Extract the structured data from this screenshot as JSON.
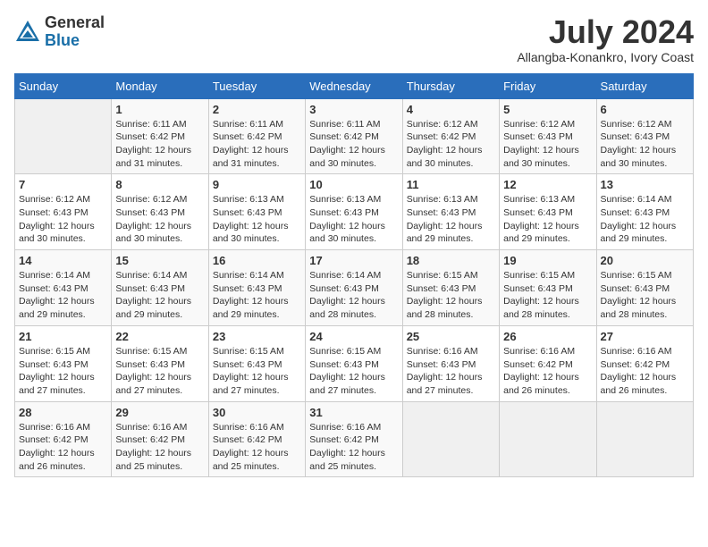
{
  "header": {
    "logo_general": "General",
    "logo_blue": "Blue",
    "month_title": "July 2024",
    "subtitle": "Allangba-Konankro, Ivory Coast"
  },
  "days_of_week": [
    "Sunday",
    "Monday",
    "Tuesday",
    "Wednesday",
    "Thursday",
    "Friday",
    "Saturday"
  ],
  "weeks": [
    [
      {
        "day": "",
        "info": ""
      },
      {
        "day": "1",
        "info": "Sunrise: 6:11 AM\nSunset: 6:42 PM\nDaylight: 12 hours\nand 31 minutes."
      },
      {
        "day": "2",
        "info": "Sunrise: 6:11 AM\nSunset: 6:42 PM\nDaylight: 12 hours\nand 31 minutes."
      },
      {
        "day": "3",
        "info": "Sunrise: 6:11 AM\nSunset: 6:42 PM\nDaylight: 12 hours\nand 30 minutes."
      },
      {
        "day": "4",
        "info": "Sunrise: 6:12 AM\nSunset: 6:42 PM\nDaylight: 12 hours\nand 30 minutes."
      },
      {
        "day": "5",
        "info": "Sunrise: 6:12 AM\nSunset: 6:43 PM\nDaylight: 12 hours\nand 30 minutes."
      },
      {
        "day": "6",
        "info": "Sunrise: 6:12 AM\nSunset: 6:43 PM\nDaylight: 12 hours\nand 30 minutes."
      }
    ],
    [
      {
        "day": "7",
        "info": "Sunrise: 6:12 AM\nSunset: 6:43 PM\nDaylight: 12 hours\nand 30 minutes."
      },
      {
        "day": "8",
        "info": "Sunrise: 6:12 AM\nSunset: 6:43 PM\nDaylight: 12 hours\nand 30 minutes."
      },
      {
        "day": "9",
        "info": "Sunrise: 6:13 AM\nSunset: 6:43 PM\nDaylight: 12 hours\nand 30 minutes."
      },
      {
        "day": "10",
        "info": "Sunrise: 6:13 AM\nSunset: 6:43 PM\nDaylight: 12 hours\nand 30 minutes."
      },
      {
        "day": "11",
        "info": "Sunrise: 6:13 AM\nSunset: 6:43 PM\nDaylight: 12 hours\nand 29 minutes."
      },
      {
        "day": "12",
        "info": "Sunrise: 6:13 AM\nSunset: 6:43 PM\nDaylight: 12 hours\nand 29 minutes."
      },
      {
        "day": "13",
        "info": "Sunrise: 6:14 AM\nSunset: 6:43 PM\nDaylight: 12 hours\nand 29 minutes."
      }
    ],
    [
      {
        "day": "14",
        "info": "Sunrise: 6:14 AM\nSunset: 6:43 PM\nDaylight: 12 hours\nand 29 minutes."
      },
      {
        "day": "15",
        "info": "Sunrise: 6:14 AM\nSunset: 6:43 PM\nDaylight: 12 hours\nand 29 minutes."
      },
      {
        "day": "16",
        "info": "Sunrise: 6:14 AM\nSunset: 6:43 PM\nDaylight: 12 hours\nand 29 minutes."
      },
      {
        "day": "17",
        "info": "Sunrise: 6:14 AM\nSunset: 6:43 PM\nDaylight: 12 hours\nand 28 minutes."
      },
      {
        "day": "18",
        "info": "Sunrise: 6:15 AM\nSunset: 6:43 PM\nDaylight: 12 hours\nand 28 minutes."
      },
      {
        "day": "19",
        "info": "Sunrise: 6:15 AM\nSunset: 6:43 PM\nDaylight: 12 hours\nand 28 minutes."
      },
      {
        "day": "20",
        "info": "Sunrise: 6:15 AM\nSunset: 6:43 PM\nDaylight: 12 hours\nand 28 minutes."
      }
    ],
    [
      {
        "day": "21",
        "info": "Sunrise: 6:15 AM\nSunset: 6:43 PM\nDaylight: 12 hours\nand 27 minutes."
      },
      {
        "day": "22",
        "info": "Sunrise: 6:15 AM\nSunset: 6:43 PM\nDaylight: 12 hours\nand 27 minutes."
      },
      {
        "day": "23",
        "info": "Sunrise: 6:15 AM\nSunset: 6:43 PM\nDaylight: 12 hours\nand 27 minutes."
      },
      {
        "day": "24",
        "info": "Sunrise: 6:15 AM\nSunset: 6:43 PM\nDaylight: 12 hours\nand 27 minutes."
      },
      {
        "day": "25",
        "info": "Sunrise: 6:16 AM\nSunset: 6:43 PM\nDaylight: 12 hours\nand 27 minutes."
      },
      {
        "day": "26",
        "info": "Sunrise: 6:16 AM\nSunset: 6:42 PM\nDaylight: 12 hours\nand 26 minutes."
      },
      {
        "day": "27",
        "info": "Sunrise: 6:16 AM\nSunset: 6:42 PM\nDaylight: 12 hours\nand 26 minutes."
      }
    ],
    [
      {
        "day": "28",
        "info": "Sunrise: 6:16 AM\nSunset: 6:42 PM\nDaylight: 12 hours\nand 26 minutes."
      },
      {
        "day": "29",
        "info": "Sunrise: 6:16 AM\nSunset: 6:42 PM\nDaylight: 12 hours\nand 25 minutes."
      },
      {
        "day": "30",
        "info": "Sunrise: 6:16 AM\nSunset: 6:42 PM\nDaylight: 12 hours\nand 25 minutes."
      },
      {
        "day": "31",
        "info": "Sunrise: 6:16 AM\nSunset: 6:42 PM\nDaylight: 12 hours\nand 25 minutes."
      },
      {
        "day": "",
        "info": ""
      },
      {
        "day": "",
        "info": ""
      },
      {
        "day": "",
        "info": ""
      }
    ]
  ]
}
